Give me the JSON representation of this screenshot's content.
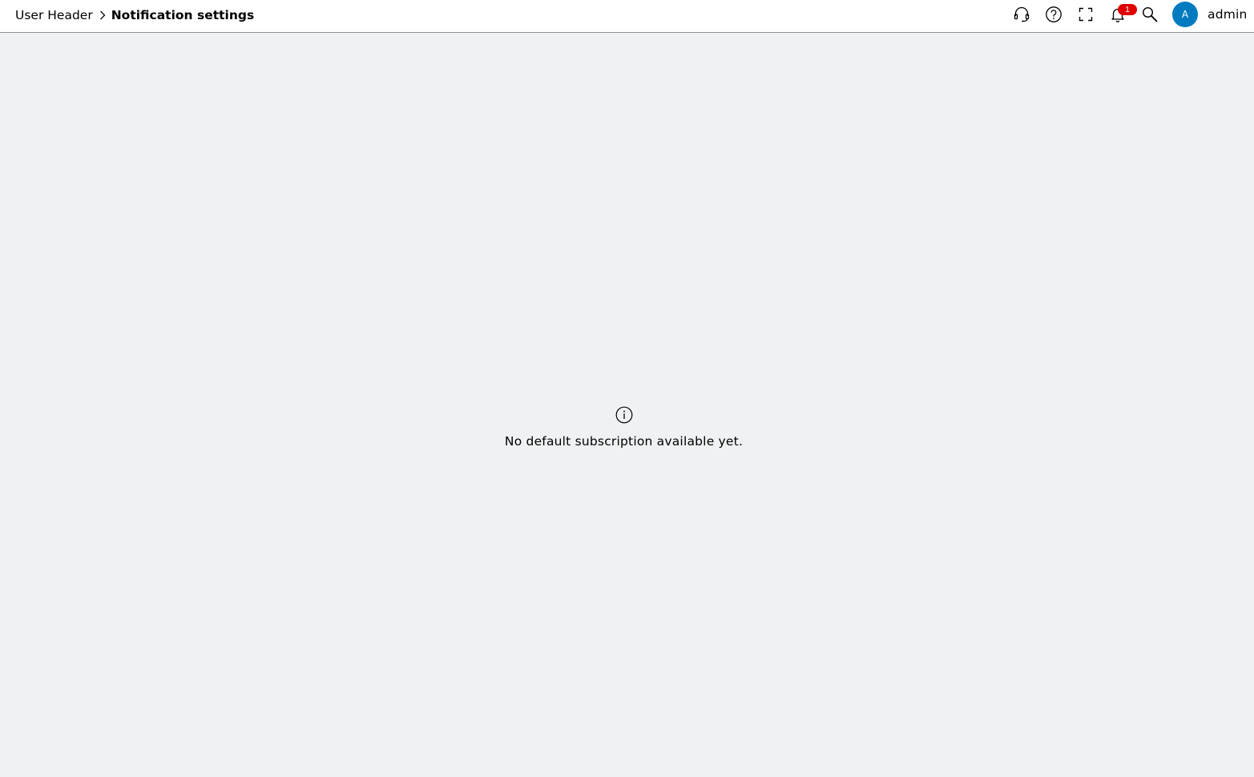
{
  "breadcrumb": {
    "parent_label": "User Header",
    "current_label": "Notification settings"
  },
  "header_actions": {
    "icons": [
      "headset-icon",
      "help-icon",
      "fullscreen-icon",
      "bell-icon",
      "search-icon"
    ],
    "notification_count": "1",
    "avatar_initial": "A",
    "username": "admin"
  },
  "main": {
    "empty_icon": "info-icon",
    "empty_message": "No default subscription available yet."
  },
  "colors": {
    "header_bg": "#ffffff",
    "page_bg": "#eff1f2",
    "avatar_bg": "#007bc0",
    "badge_bg": "#e00000",
    "header_border": "#8a9097"
  }
}
